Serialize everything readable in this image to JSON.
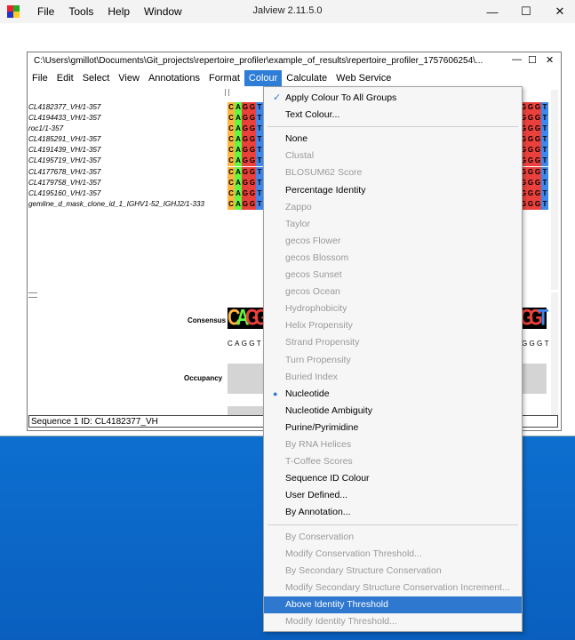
{
  "app": {
    "title": "Jalview 2.11.5.0",
    "menus": [
      "File",
      "Tools",
      "Help",
      "Window"
    ],
    "controls": {
      "minimize": "—",
      "maximize": "☐",
      "close": "✕"
    }
  },
  "inner": {
    "path": "C:\\Users\\gmillot\\Documents\\Git_projects\\repertoire_profiler\\example_of_results\\repertoire_profiler_1757606254\\...",
    "controls": {
      "minimize": "—",
      "maximize": "☐",
      "close": "✕"
    },
    "menus": [
      "File",
      "Edit",
      "Select",
      "View",
      "Annotations",
      "Format",
      "Colour",
      "Calculate",
      "Web Service"
    ],
    "active_menu": "Colour"
  },
  "sequences": [
    "CL4182377_VH/1-357",
    "CL4194433_VH/1-357",
    "roc1/1-357",
    "CL4185291_VH/1-357",
    "CL4191439_VH/1-357",
    "CL4195719_VH/1-357",
    "CL4177678_VH/1-357",
    "CL4179758_VH/1-357",
    "CL4195160_VH/1-357",
    "gemline_d_mask_clone_id_1_IGHV1-52_IGHJ2/1-333"
  ],
  "alignment_left": "CAGGT",
  "alignment_right": "GGGT",
  "annotations": {
    "consensus_label": "Consensus",
    "occupancy_label": "Occupancy",
    "consensus_logo": "CAGGT",
    "consensus_seq": "CAGGT",
    "right_logo": "GGT",
    "right_seq": "GGGT"
  },
  "status": "Sequence 1 ID: CL4182377_VH",
  "colour_menu": {
    "items": [
      {
        "label": "Apply Colour To All Groups",
        "checked": true,
        "enabled": true
      },
      {
        "label": "Text Colour...",
        "enabled": true
      },
      {
        "sep": true
      },
      {
        "label": "None",
        "enabled": true
      },
      {
        "label": "Clustal",
        "enabled": false
      },
      {
        "label": "BLOSUM62 Score",
        "enabled": false
      },
      {
        "label": "Percentage Identity",
        "enabled": true
      },
      {
        "label": "Zappo",
        "enabled": false
      },
      {
        "label": "Taylor",
        "enabled": false
      },
      {
        "label": "gecos Flower",
        "enabled": false
      },
      {
        "label": "gecos Blossom",
        "enabled": false
      },
      {
        "label": "gecos Sunset",
        "enabled": false
      },
      {
        "label": "gecos Ocean",
        "enabled": false
      },
      {
        "label": "Hydrophobicity",
        "enabled": false
      },
      {
        "label": "Helix Propensity",
        "enabled": false
      },
      {
        "label": "Strand Propensity",
        "enabled": false
      },
      {
        "label": "Turn Propensity",
        "enabled": false
      },
      {
        "label": "Buried Index",
        "enabled": false
      },
      {
        "label": "Nucleotide",
        "enabled": true,
        "selected": true
      },
      {
        "label": "Nucleotide Ambiguity",
        "enabled": true
      },
      {
        "label": "Purine/Pyrimidine",
        "enabled": true
      },
      {
        "label": "By RNA Helices",
        "enabled": false
      },
      {
        "label": "T-Coffee Scores",
        "enabled": false
      },
      {
        "label": "Sequence ID Colour",
        "enabled": true
      },
      {
        "label": "User Defined...",
        "enabled": true
      },
      {
        "label": "By Annotation...",
        "enabled": true
      },
      {
        "sep": true
      },
      {
        "label": "By Conservation",
        "enabled": false
      },
      {
        "label": "Modify Conservation Threshold...",
        "enabled": false
      },
      {
        "label": "By Secondary Structure Conservation",
        "enabled": false
      },
      {
        "label": "Modify Secondary Structure Conservation Increment...",
        "enabled": false
      },
      {
        "label": "Above Identity Threshold",
        "enabled": true,
        "highlighted": true
      },
      {
        "label": "Modify Identity Threshold...",
        "enabled": false
      }
    ]
  },
  "colors": {
    "A": "#64f73f",
    "C": "#ffb340",
    "G": "#eb413c",
    "T": "#3c88ee",
    "highlight": "#2f78cf",
    "desktop": "#0a63c4"
  }
}
